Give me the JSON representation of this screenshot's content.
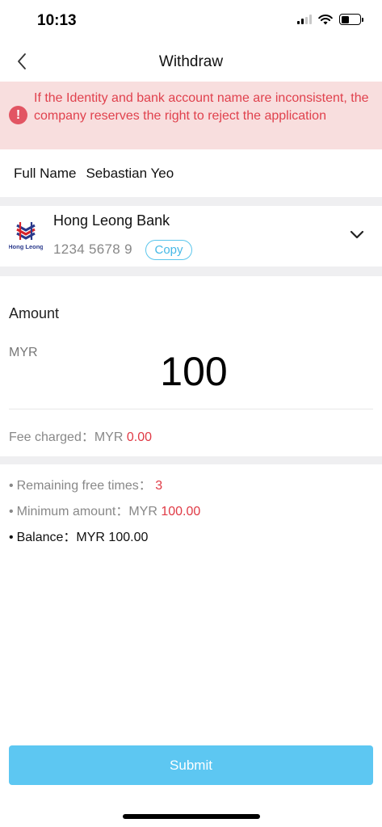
{
  "status_bar": {
    "time": "10:13"
  },
  "nav": {
    "title": "Withdraw"
  },
  "warning": {
    "icon_glyph": "!",
    "text": "If the Identity and bank account name are inconsistent, the company reserves the right to reject the application"
  },
  "full_name": {
    "label": "Full Name",
    "value": "Sebastian Yeo"
  },
  "bank": {
    "name": "Hong Leong Bank",
    "account": "1234 5678 9",
    "copy_label": "Copy",
    "logo_text": "Hong Leong"
  },
  "amount": {
    "label": "Amount",
    "currency": "MYR",
    "value": "100"
  },
  "fee": {
    "label": "Fee charged：MYR ",
    "value": "0.00"
  },
  "info": {
    "remaining_label": "Remaining free times：",
    "remaining_value": "3",
    "minimum_label": "Minimum amount：MYR ",
    "minimum_value": "100.00",
    "balance_label": "Balance：MYR 100.00"
  },
  "submit_label": "Submit",
  "colors": {
    "accent": "#5dc7f2",
    "warning_bg": "#f8dede",
    "warning_text": "#e0414d",
    "highlight_red": "#e03a45"
  },
  "icons": [
    "back-arrow",
    "cellular-signal",
    "wifi",
    "battery",
    "exclamation-circle",
    "bank-logo",
    "chevron-down"
  ]
}
